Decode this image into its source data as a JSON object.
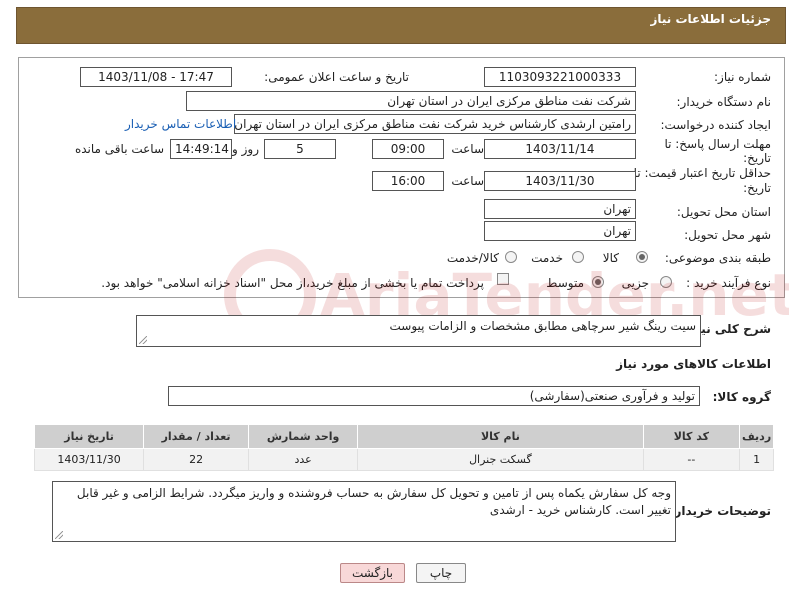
{
  "header": {
    "title": "جزئیات اطلاعات نیاز"
  },
  "form": {
    "need_number_label": "شماره نیاز:",
    "need_number": "1103093221000333",
    "announce_label": "تاریخ و ساعت اعلان عمومی:",
    "announce_value": "1403/11/08 - 17:47",
    "buyer_org_label": "نام دستگاه خریدار:",
    "buyer_org": "شرکت نفت مناطق مرکزی ایران در استان تهران",
    "creator_label": "ایجاد کننده درخواست:",
    "creator": "رامتین ارشدی کارشناس خرید شرکت نفت مناطق مرکزی ایران در استان تهران",
    "contact_link": "اطلاعات تماس خریدار",
    "deadline_label_1": "مهلت ارسال پاسخ: تا",
    "deadline_label_2": "تاریخ:",
    "deadline_date": "1403/11/14",
    "time_label": "ساعت",
    "deadline_time": "09:00",
    "days_value": "5",
    "days_label": "روز و",
    "remaining_time": "14:49:14",
    "remaining_label": "ساعت باقی مانده",
    "validity_label_1": "حداقل تاریخ اعتبار قیمت: تا",
    "validity_label_2": "تاریخ:",
    "validity_date": "1403/11/30",
    "validity_time": "16:00",
    "province_label": "استان محل تحویل:",
    "province": "تهران",
    "city_label": "شهر محل تحویل:",
    "city": "تهران",
    "category_label": "طبقه بندی موضوعی:",
    "category_options": [
      "کالا",
      "خدمت",
      "کالا/خدمت"
    ],
    "process_label": "نوع فرآیند خرید :",
    "process_options": [
      "جزیی",
      "متوسط"
    ],
    "payment_note": "پرداخت تمام یا بخشی از مبلغ خرید،از محل \"اسناد خزانه اسلامی\" خواهد بود."
  },
  "summary": {
    "label": "شرح کلی نیاز:",
    "value": "سیت رینگ شیر سرچاهی مطابق مشخصات و الزامات پیوست"
  },
  "goods": {
    "section_title": "اطلاعات کالاهای مورد نیاز",
    "group_label": "گروه کالا:",
    "group_value": "تولید و فرآوری صنعتی(سفارشی)",
    "columns": [
      "ردیف",
      "کد کالا",
      "نام کالا",
      "واحد شمارش",
      "تعداد / مقدار",
      "تاریخ نیاز"
    ],
    "rows": [
      {
        "index": "1",
        "code": "--",
        "name": "گسکت جنرال",
        "unit": "عدد",
        "qty": "22",
        "date": "1403/11/30"
      }
    ]
  },
  "buyer_notes": {
    "label": "توضیحات خریدار:",
    "value": "وجه کل سفارش یکماه پس از تامین و تحویل کل سفارش به حساب فروشنده و واریز میگردد. شرایط الزامی و غیر قابل تغییر است. کارشناس خرید - ارشدی"
  },
  "buttons": {
    "print": "چاپ",
    "back": "بازگشت"
  },
  "watermark_text": "AriaTender.net"
}
